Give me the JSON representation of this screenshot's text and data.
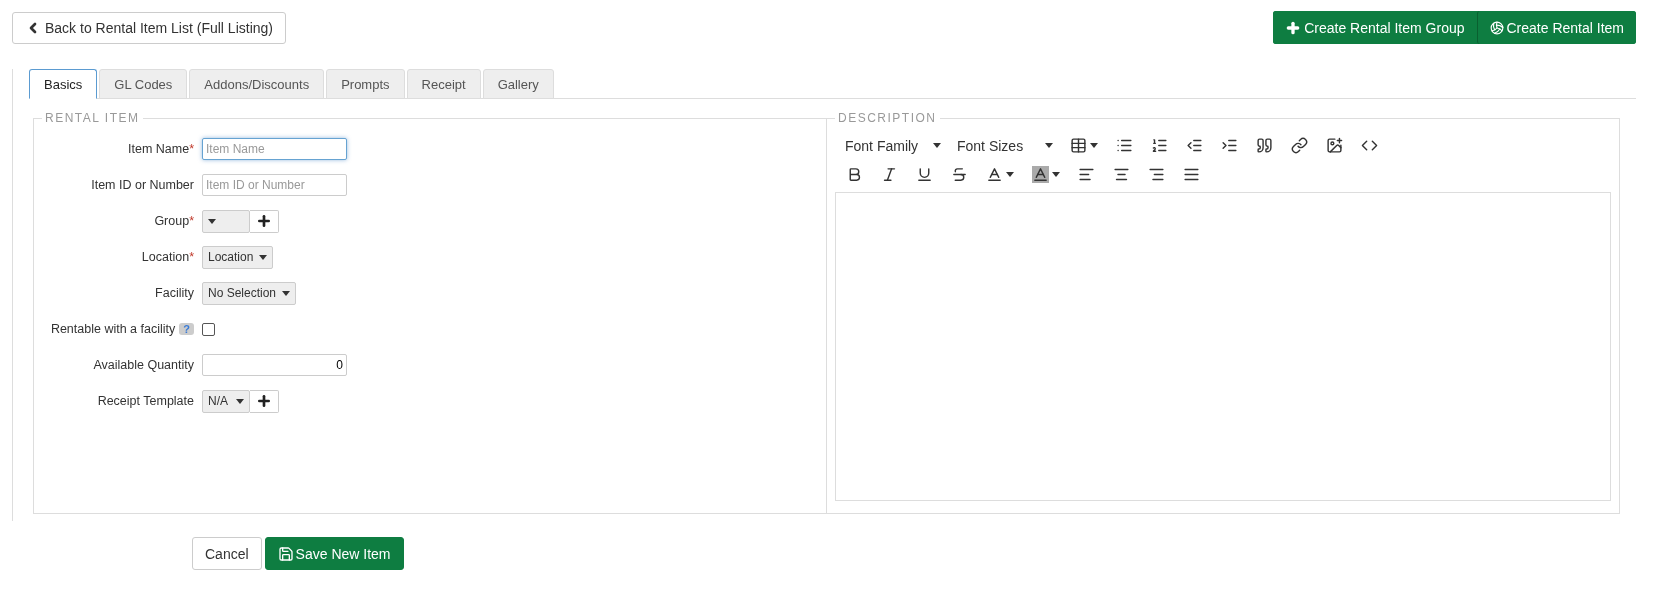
{
  "header": {
    "back_button": "Back to Rental Item List (Full Listing)",
    "actions": [
      {
        "kind": "plus",
        "label": "Create Rental Item Group"
      },
      {
        "kind": "ball",
        "label": "Create Rental Item"
      }
    ]
  },
  "tabs": [
    {
      "label": "Basics",
      "selected": true
    },
    {
      "label": "GL Codes",
      "selected": false
    },
    {
      "label": "Addons/Discounts",
      "selected": false
    },
    {
      "label": "Prompts",
      "selected": false
    },
    {
      "label": "Receipt",
      "selected": false
    },
    {
      "label": "Gallery",
      "selected": false
    }
  ],
  "rental_item": {
    "legend": "RENTAL ITEM",
    "fields": [
      {
        "kind": "text",
        "label": "Item Name",
        "required_mark": "*",
        "placeholder": "Item Name",
        "focused": true
      },
      {
        "kind": "text",
        "label": "Item ID or Number",
        "placeholder": "Item ID or Number",
        "focused": false
      },
      {
        "kind": "select_add",
        "label": "Group",
        "required_mark": "*"
      },
      {
        "kind": "select",
        "label": "Location",
        "required_mark": "*",
        "value": "Location"
      },
      {
        "kind": "select",
        "label": "Facility",
        "value": "No Selection"
      },
      {
        "kind": "checkbox",
        "label": "Rentable with a facility",
        "help": "?",
        "checked": false
      },
      {
        "kind": "number",
        "label": "Available Quantity",
        "value": "0",
        "focused": false
      },
      {
        "kind": "select_add",
        "label": "Receipt Template",
        "value": "N/A"
      }
    ]
  },
  "description": {
    "legend": "DESCRIPTION",
    "dropdowns": [
      "Font Family",
      "Font Sizes"
    ]
  },
  "footer": {
    "buttons": [
      {
        "kind": "plain",
        "label": "Cancel"
      },
      {
        "kind": "save",
        "label": "Save New Item"
      }
    ]
  }
}
